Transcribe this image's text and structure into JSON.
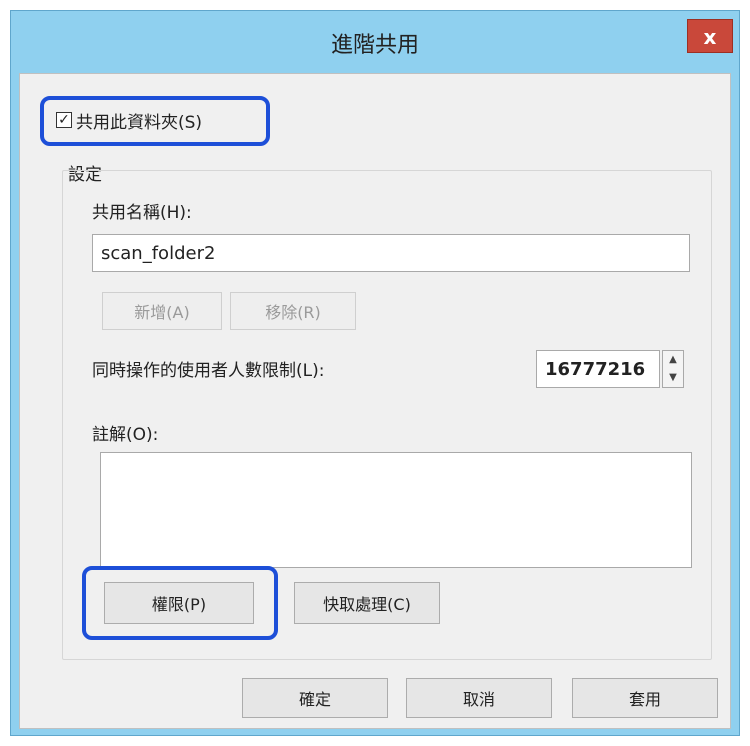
{
  "dialog": {
    "title": "進階共用",
    "close_label": "x"
  },
  "share_checkbox": {
    "checked": true,
    "label": "共用此資料夾(S)"
  },
  "settings": {
    "group_label": "設定",
    "share_name_label": "共用名稱(H):",
    "share_name_value": "scan_folder2",
    "add_button": "新增(A)",
    "remove_button": "移除(R)",
    "user_limit_label": "同時操作的使用者人數限制(L):",
    "user_limit_value": "16777216",
    "comment_label": "註解(O):",
    "comment_value": "",
    "permissions_button": "權限(P)",
    "caching_button": "快取處理(C)"
  },
  "footer": {
    "ok_button": "確定",
    "cancel_button": "取消",
    "apply_button": "套用"
  },
  "colors": {
    "highlight": "#1d4fd8",
    "titlebar": "#8fd0ef",
    "close": "#c9483a"
  }
}
